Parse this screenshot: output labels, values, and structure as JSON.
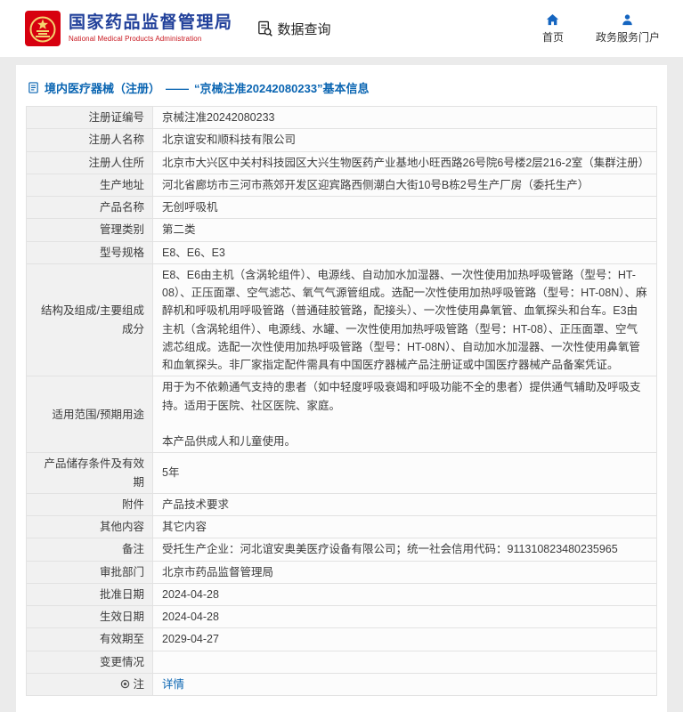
{
  "header": {
    "title_cn": "国家药品监督管理局",
    "title_en": "National Medical Products Administration",
    "query_label": "数据查询",
    "nav_home": "首页",
    "nav_portal": "政务服务门户"
  },
  "breadcrumb": {
    "section": "境内医疗器械（注册）",
    "dash": "——",
    "title": "“京械注准20242080233”基本信息"
  },
  "icons": {
    "logo": "nmpa-emblem",
    "query": "document-magnifier-icon",
    "home": "home-icon",
    "portal": "user-icon",
    "breadcrumb": "document-icon",
    "note": "circle-dot-icon"
  },
  "colors": {
    "title_blue": "#21409a",
    "subtitle_red": "#c8161e",
    "link_blue": "#0a65b2",
    "nav_icon_blue": "#1565c0",
    "label_bg": "#f1f1f1",
    "page_bg": "#ebebeb"
  },
  "table": {
    "rows": [
      {
        "label": "注册证编号",
        "value": "京械注准20242080233"
      },
      {
        "label": "注册人名称",
        "value": "北京谊安和顺科技有限公司"
      },
      {
        "label": "注册人住所",
        "value": "北京市大兴区中关村科技园区大兴生物医药产业基地小旺西路26号院6号楼2层216-2室（集群注册）"
      },
      {
        "label": "生产地址",
        "value": "河北省廊坊市三河市燕郊开发区迎宾路西侧潮白大街10号B栋2号生产厂房（委托生产）"
      },
      {
        "label": "产品名称",
        "value": "无创呼吸机"
      },
      {
        "label": "管理类别",
        "value": "第二类"
      },
      {
        "label": "型号规格",
        "value": "E8、E6、E3"
      },
      {
        "label": "结构及组成/主要组成成分",
        "value": "E8、E6由主机（含涡轮组件）、电源线、自动加水加湿器、一次性使用加热呼吸管路（型号：HT-08）、正压面罩、空气滤芯、氧气气源管组成。选配一次性使用加热呼吸管路（型号：HT-08N）、麻醉机和呼吸机用呼吸管路（普通硅胶管路，配接头）、一次性使用鼻氧管、血氧探头和台车。E3由主机（含涡轮组件）、电源线、水罐、一次性使用加热呼吸管路（型号：HT-08）、正压面罩、空气滤芯组成。选配一次性使用加热呼吸管路（型号：HT-08N）、自动加水加湿器、一次性使用鼻氧管和血氧探头。非厂家指定配件需具有中国医疗器械产品注册证或中国医疗器械产品备案凭证。"
      },
      {
        "label": "适用范围/预期用途",
        "value": "用于为不依赖通气支持的患者（如中轻度呼吸衰竭和呼吸功能不全的患者）提供通气辅助及呼吸支持。适用于医院、社区医院、家庭。\n\n本产品供成人和儿童使用。"
      },
      {
        "label": "产品储存条件及有效期",
        "value": "5年"
      },
      {
        "label": "附件",
        "value": "产品技术要求"
      },
      {
        "label": "其他内容",
        "value": "其它内容"
      },
      {
        "label": "备注",
        "value": "受托生产企业：河北谊安奥美医疗设备有限公司；统一社会信用代码：911310823480235965"
      },
      {
        "label": "审批部门",
        "value": "北京市药品监督管理局"
      },
      {
        "label": "批准日期",
        "value": "2024-04-28"
      },
      {
        "label": "生效日期",
        "value": "2024-04-28"
      },
      {
        "label": "有效期至",
        "value": "2029-04-27"
      },
      {
        "label": "变更情况",
        "value": ""
      },
      {
        "label": "注",
        "value": "详情",
        "link": true,
        "label_icon": "circle-dot-icon"
      }
    ]
  }
}
